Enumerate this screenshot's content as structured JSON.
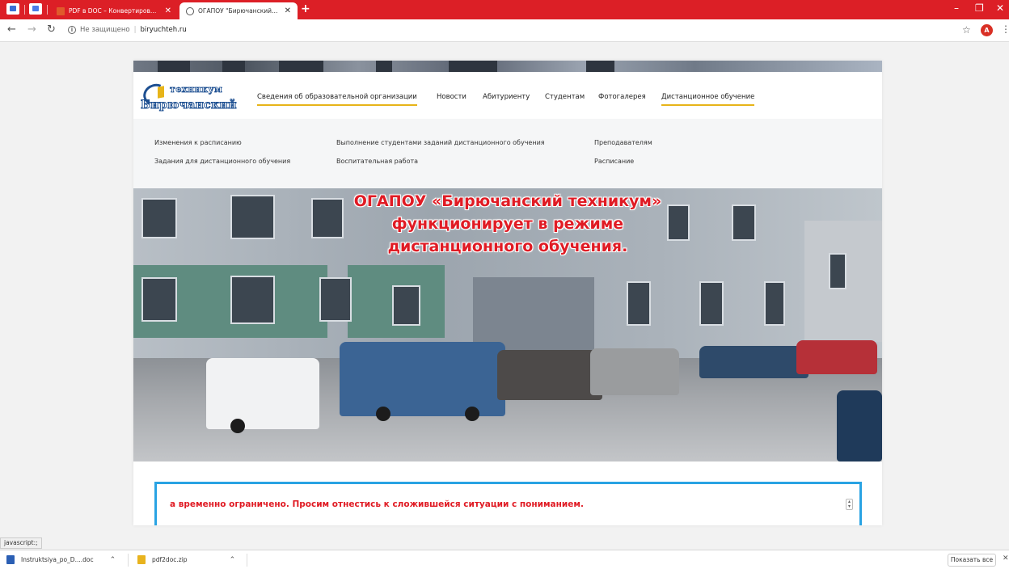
{
  "browser": {
    "tabs": [
      {
        "label": "PDF в DOC – Конвертировать PDF"
      },
      {
        "label": "ОГАПОУ \"Бирючанский техникум\""
      }
    ],
    "address": {
      "security_label": "Не защищено",
      "url": "biryuchteh.ru"
    },
    "profile_initial": "A",
    "accent_color": "#dc1f26"
  },
  "site": {
    "logo": {
      "line1": "техникум",
      "line2": "Бирючанский"
    },
    "nav": [
      {
        "label": "Сведения об образовательной организации"
      },
      {
        "label": "Новости"
      },
      {
        "label": "Абитуриенту"
      },
      {
        "label": "Студентам"
      },
      {
        "label": "Фотогалерея"
      },
      {
        "label": "Дистанционное обучение"
      }
    ],
    "submenu": [
      {
        "label": "Изменения к расписанию"
      },
      {
        "label": "Выполнение студентами заданий дистанционного обучения"
      },
      {
        "label": "Преподавателям"
      },
      {
        "label": "Задания для дистанционного обучения"
      },
      {
        "label": "Воспитательная работа"
      },
      {
        "label": "Расписание"
      }
    ],
    "hero": {
      "line1": "ОГАПОУ «Бирючанский техникум»",
      "line2": "функционирует в режиме",
      "line3": "дистанционного обучения."
    },
    "ticker": "а временно ограничено. Просим отнестись к сложившейся ситуации с пониманием."
  },
  "status_text": "javascript:;",
  "downloads": {
    "items": [
      {
        "name": "Instruktsiya_po_D....doc"
      },
      {
        "name": "pdf2doc.zip"
      }
    ],
    "show_all": "Показать все"
  }
}
